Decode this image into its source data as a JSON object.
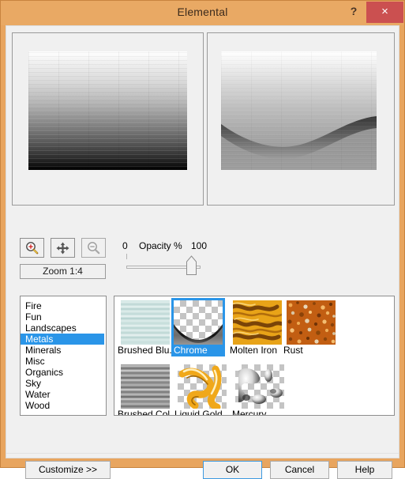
{
  "window": {
    "title": "Elemental",
    "help_button": "?",
    "close_button": "×",
    "accent_color": "#e9a964",
    "close_color": "#cb5050",
    "selection_color": "#2a95e8"
  },
  "preview": {
    "before_label": "original-preview",
    "after_label": "effect-preview"
  },
  "toolbar": {
    "zoom_in": "zoom-in",
    "pan": "pan",
    "zoom_out": "zoom-out",
    "zoom_level": "Zoom 1:4"
  },
  "opacity": {
    "min": "0",
    "label": "Opacity %",
    "max": "100",
    "value": 100
  },
  "categories": {
    "selected": "Metals",
    "items": [
      {
        "label": "Fire"
      },
      {
        "label": "Fun"
      },
      {
        "label": "Landscapes"
      },
      {
        "label": "Metals"
      },
      {
        "label": "Minerals"
      },
      {
        "label": "Misc"
      },
      {
        "label": "Organics"
      },
      {
        "label": "Sky"
      },
      {
        "label": "Water"
      },
      {
        "label": "Wood"
      }
    ]
  },
  "gallery": {
    "selected": "Chrome",
    "items": [
      {
        "label": "Brushed Blu...",
        "kind": "brushed-blue"
      },
      {
        "label": "Chrome",
        "kind": "chrome"
      },
      {
        "label": "Molten Iron",
        "kind": "molten-iron"
      },
      {
        "label": "Rust",
        "kind": "rust"
      },
      {
        "label": "Brushed Col...",
        "kind": "brushed-color"
      },
      {
        "label": "Liquid Gold",
        "kind": "liquid-gold"
      },
      {
        "label": "Mercury",
        "kind": "mercury"
      }
    ]
  },
  "buttons": {
    "customize": "Customize  >>",
    "ok": "OK",
    "cancel": "Cancel",
    "help": "Help"
  }
}
